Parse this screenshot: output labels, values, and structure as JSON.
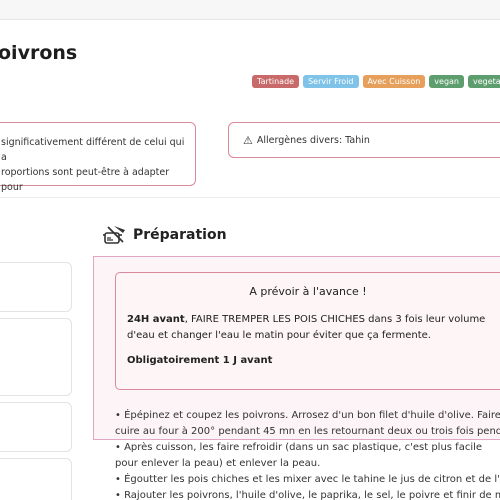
{
  "page": {
    "title": "oivrons"
  },
  "tags": [
    {
      "label": "Tartinade",
      "color": "#c96a6a"
    },
    {
      "label": "Servir Froid",
      "color": "#7fc4e8"
    },
    {
      "label": "Avec Cuisson",
      "color": "#e6a05c"
    },
    {
      "label": "vegan",
      "color": "#5e9e6e"
    },
    {
      "label": "vegetarie",
      "color": "#5e9e6e"
    }
  ],
  "note": {
    "line1": "significativement différent de celui qui a",
    "line2": "roportions sont peut-être à adapter pour"
  },
  "allergens": {
    "text": "Allergènes divers: Tahin"
  },
  "preparation": {
    "heading": "Préparation",
    "advance": {
      "title": "A prévoir à l'avance !",
      "bold_lead": "24H avant",
      "line1_rest": ", FAIRE TREMPER LES POIS CHICHES dans 3 fois leur volume",
      "line2": "d'eau et changer l'eau le matin pour éviter que ça fermente.",
      "obligation": "Obligatoirement 1 J avant"
    },
    "steps": [
      "• Épépinez et coupez les poivrons. Arrosez d'un bon filet d'huile d'olive. Faire",
      "cuire au four à 200° pendant 45 mn en les retournant deux ou trois fois pend",
      "• Après cuisson, les faire refroidir (dans un sac plastique, c'est plus facile",
      "pour enlever la peau) et enlever la peau.",
      "• Égoutter les pois chiches et les mixer avec le tahine le jus de citron et de l'ai",
      "• Rajouter les poivrons, l'huile d'olive, le paprika, le sel, le poivre et finir de mi"
    ]
  }
}
